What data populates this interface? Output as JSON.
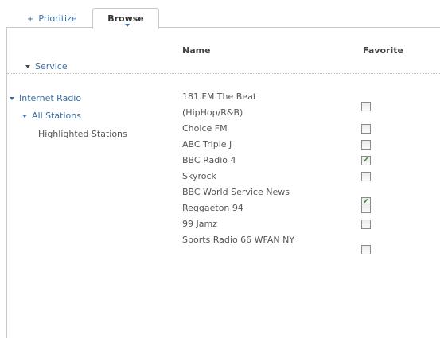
{
  "tabs": {
    "prioritize": {
      "icon": "+",
      "label": "Prioritize"
    },
    "browse": {
      "label": "Browse"
    }
  },
  "columns": {
    "name": "Name",
    "favorite": "Favorite"
  },
  "service": {
    "label": "Service"
  },
  "tree": {
    "root": "Internet Radio",
    "all_stations": "All Stations",
    "highlighted": "Highlighted Stations"
  },
  "stations": [
    {
      "name": "181.FM The Beat (HipHop/R&B)",
      "favorite": false,
      "lines": 2
    },
    {
      "name": "Choice FM",
      "favorite": false,
      "lines": 1
    },
    {
      "name": "ABC Triple J",
      "favorite": false,
      "lines": 1
    },
    {
      "name": "BBC Radio 4",
      "favorite": true,
      "lines": 1
    },
    {
      "name": "Skyrock",
      "favorite": false,
      "lines": 1
    },
    {
      "name": "BBC World Service News",
      "favorite": true,
      "lines": 2
    },
    {
      "name": "Reggaeton 94",
      "favorite": false,
      "lines": 1
    },
    {
      "name": "99 Jamz",
      "favorite": false,
      "lines": 1
    },
    {
      "name": "Sports Radio 66 WFAN NY",
      "favorite": false,
      "lines": 2
    }
  ],
  "colors": {
    "link": "#3a6ea5",
    "check": "#3f8f3f"
  }
}
